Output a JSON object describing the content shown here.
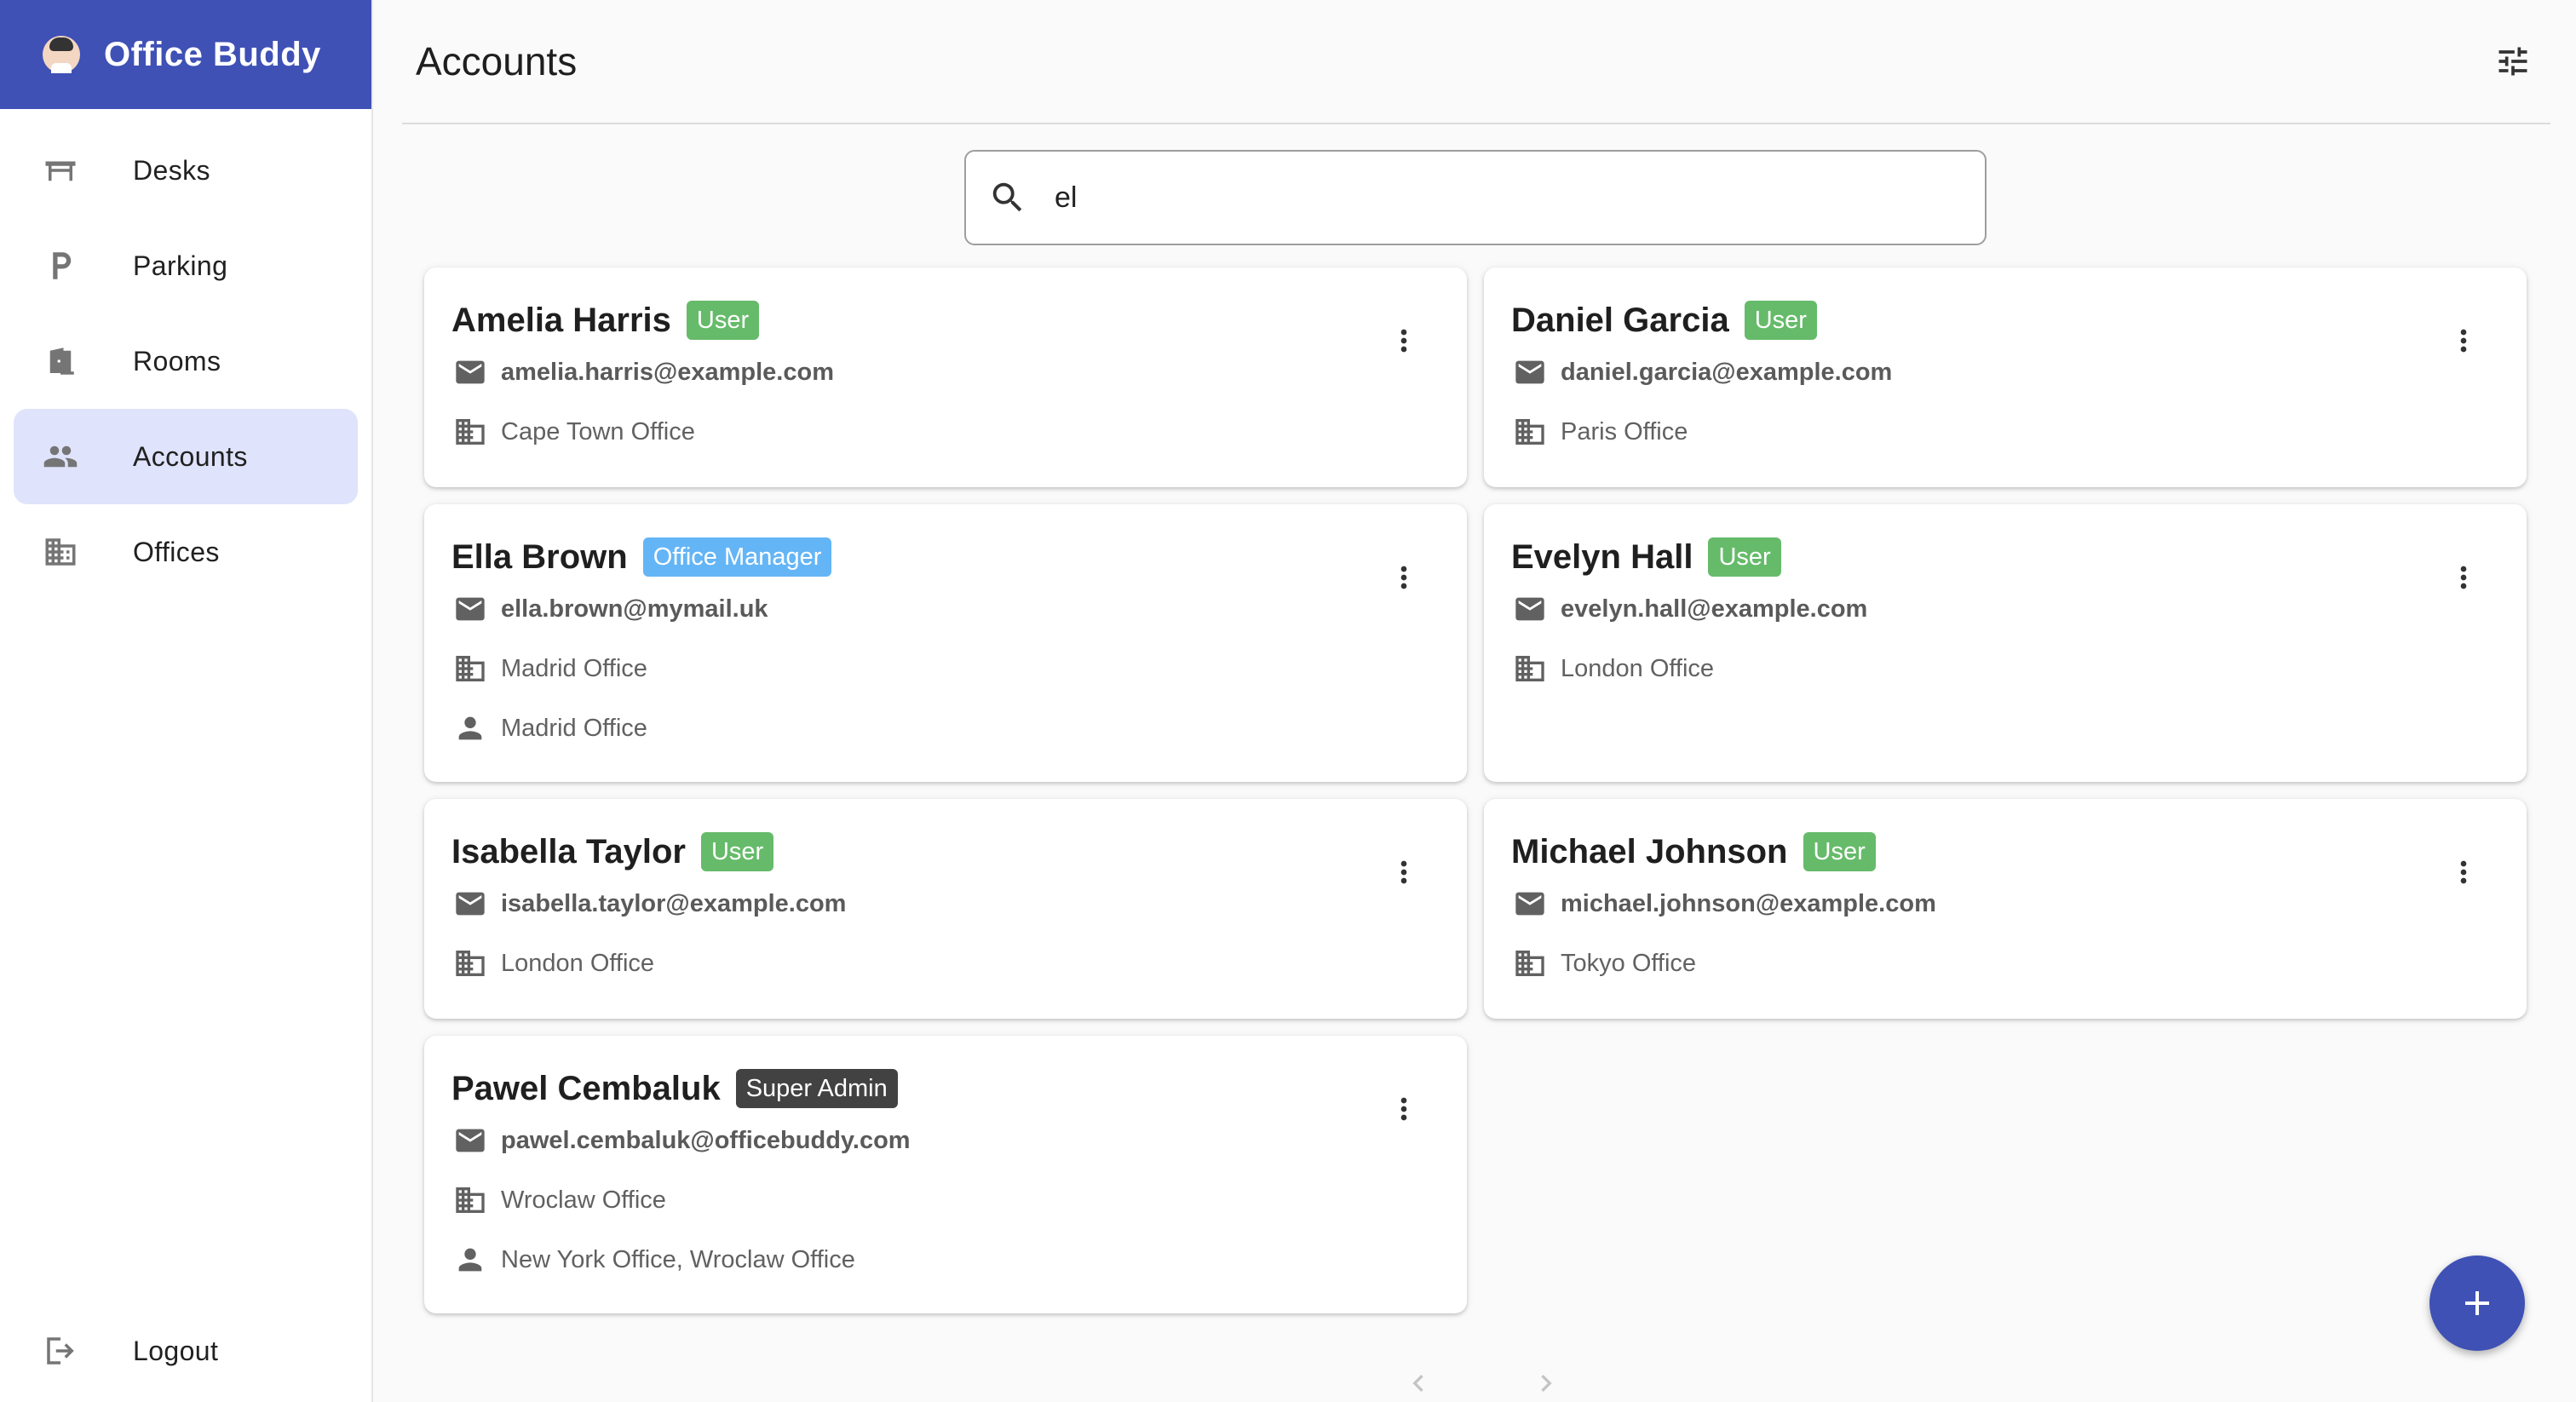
{
  "app": {
    "title": "Office Buddy",
    "logo_icon": "person-avatar-icon"
  },
  "sidebar": {
    "items": [
      {
        "label": "Desks",
        "icon": "desk-icon",
        "active": false
      },
      {
        "label": "Parking",
        "icon": "parking-icon",
        "active": false
      },
      {
        "label": "Rooms",
        "icon": "door-icon",
        "active": false
      },
      {
        "label": "Accounts",
        "icon": "people-icon",
        "active": true
      },
      {
        "label": "Offices",
        "icon": "building-icon",
        "active": false
      }
    ],
    "logout": {
      "label": "Logout",
      "icon": "logout-icon"
    }
  },
  "header": {
    "title": "Accounts",
    "filter_icon": "tune-icon"
  },
  "search": {
    "value": "el",
    "icon": "search-icon"
  },
  "colors": {
    "primary": "#3f51b5",
    "user_badge": "#66bb6a",
    "manager_badge": "#64b5f6",
    "admin_badge": "#424242",
    "active_nav": "#dfe3fb"
  },
  "accounts": [
    {
      "name": "Amelia Harris",
      "role": "User",
      "email": "amelia.harris@example.com",
      "office": "Cape Town Office",
      "managed": ""
    },
    {
      "name": "Daniel Garcia",
      "role": "User",
      "email": "daniel.garcia@example.com",
      "office": "Paris Office",
      "managed": ""
    },
    {
      "name": "Ella Brown",
      "role": "Office Manager",
      "email": "ella.brown@mymail.uk",
      "office": "Madrid Office",
      "managed": "Madrid Office"
    },
    {
      "name": "Evelyn Hall",
      "role": "User",
      "email": "evelyn.hall@example.com",
      "office": "London Office",
      "managed": ""
    },
    {
      "name": "Isabella Taylor",
      "role": "User",
      "email": "isabella.taylor@example.com",
      "office": "London Office",
      "managed": ""
    },
    {
      "name": "Michael Johnson",
      "role": "User",
      "email": "michael.johnson@example.com",
      "office": "Tokyo Office",
      "managed": ""
    },
    {
      "name": "Pawel Cembaluk",
      "role": "Super Admin",
      "email": "pawel.cembaluk@officebuddy.com",
      "office": "Wroclaw Office",
      "managed": "New York Office, Wroclaw Office"
    }
  ],
  "fab": {
    "icon": "plus-icon"
  },
  "pagination": {
    "prev_icon": "chevron-left-icon",
    "next_icon": "chevron-right-icon"
  }
}
